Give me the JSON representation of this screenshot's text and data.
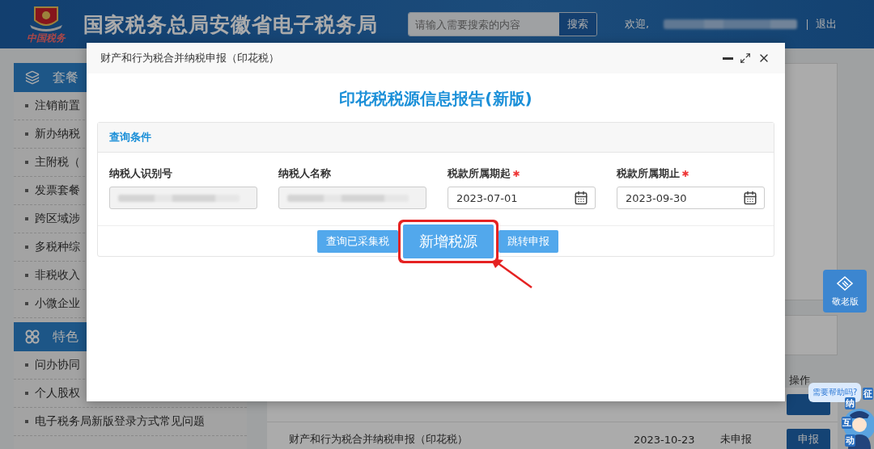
{
  "header": {
    "title": "国家税务总局安徽省电子税务局",
    "logo_caption": "中国税务",
    "search": {
      "placeholder": "请输入需要搜索的内容",
      "button": "搜索"
    },
    "welcome": "欢迎,",
    "logout": "退出"
  },
  "sidebar": {
    "groups": [
      {
        "title": "套餐",
        "items": [
          "注销前置",
          "新办纳税",
          "主附税（",
          "发票套餐",
          "跨区域涉",
          "多税种综",
          "非税收入",
          "小微企业"
        ]
      },
      {
        "title": "特色",
        "items": [
          "问办协同",
          "个人股权",
          "电子税务局新版登录方式常见问题"
        ]
      }
    ]
  },
  "elder_mode": "敬老版",
  "table": {
    "action_header": "操作",
    "rows": [
      {
        "name": "财产和行为税合并纳税申报（印花税）",
        "date": "2023-10-23",
        "status": "未申报",
        "action": "申报"
      }
    ]
  },
  "help": {
    "bubble": "需要帮助吗?",
    "mascot_label": "征纳互动"
  },
  "dialog": {
    "title": "财产和行为税合并纳税申报（印花税）",
    "heading": "印花税税源信息报告(新版)",
    "panel": {
      "title": "查询条件",
      "fields": [
        {
          "label": "纳税人识别号",
          "required": false,
          "kind": "masked"
        },
        {
          "label": "纳税人名称",
          "required": false,
          "kind": "masked"
        },
        {
          "label": "税款所属期起",
          "required": true,
          "kind": "date",
          "value": "2023-07-01"
        },
        {
          "label": "税款所属期止",
          "required": true,
          "kind": "date",
          "value": "2023-09-30"
        }
      ],
      "buttons": [
        {
          "label": "查询已采集税",
          "highlighted": false
        },
        {
          "label": "新增税源",
          "highlighted": true
        },
        {
          "label": "跳转申报",
          "highlighted": false
        }
      ]
    }
  }
}
